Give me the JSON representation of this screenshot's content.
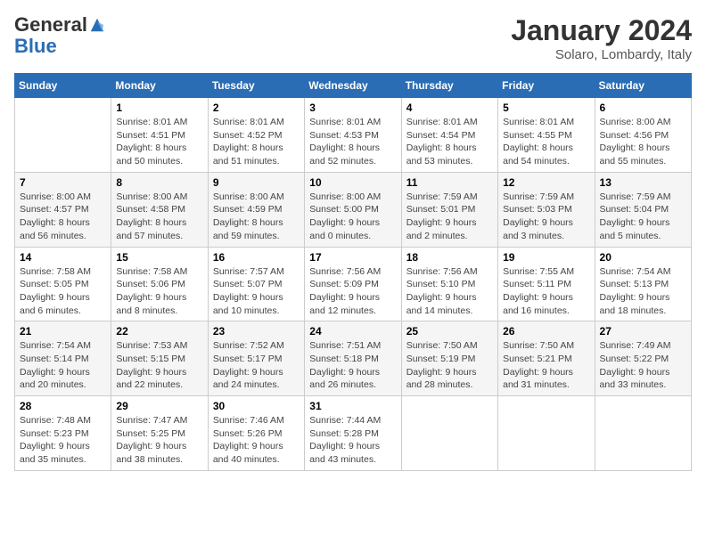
{
  "header": {
    "logo_general": "General",
    "logo_blue": "Blue",
    "month_title": "January 2024",
    "location": "Solaro, Lombardy, Italy"
  },
  "weekdays": [
    "Sunday",
    "Monday",
    "Tuesday",
    "Wednesday",
    "Thursday",
    "Friday",
    "Saturday"
  ],
  "weeks": [
    [
      {
        "day": "",
        "sunrise": "",
        "sunset": "",
        "daylight": ""
      },
      {
        "day": "1",
        "sunrise": "Sunrise: 8:01 AM",
        "sunset": "Sunset: 4:51 PM",
        "daylight": "Daylight: 8 hours and 50 minutes."
      },
      {
        "day": "2",
        "sunrise": "Sunrise: 8:01 AM",
        "sunset": "Sunset: 4:52 PM",
        "daylight": "Daylight: 8 hours and 51 minutes."
      },
      {
        "day": "3",
        "sunrise": "Sunrise: 8:01 AM",
        "sunset": "Sunset: 4:53 PM",
        "daylight": "Daylight: 8 hours and 52 minutes."
      },
      {
        "day": "4",
        "sunrise": "Sunrise: 8:01 AM",
        "sunset": "Sunset: 4:54 PM",
        "daylight": "Daylight: 8 hours and 53 minutes."
      },
      {
        "day": "5",
        "sunrise": "Sunrise: 8:01 AM",
        "sunset": "Sunset: 4:55 PM",
        "daylight": "Daylight: 8 hours and 54 minutes."
      },
      {
        "day": "6",
        "sunrise": "Sunrise: 8:00 AM",
        "sunset": "Sunset: 4:56 PM",
        "daylight": "Daylight: 8 hours and 55 minutes."
      }
    ],
    [
      {
        "day": "7",
        "sunrise": "Sunrise: 8:00 AM",
        "sunset": "Sunset: 4:57 PM",
        "daylight": "Daylight: 8 hours and 56 minutes."
      },
      {
        "day": "8",
        "sunrise": "Sunrise: 8:00 AM",
        "sunset": "Sunset: 4:58 PM",
        "daylight": "Daylight: 8 hours and 57 minutes."
      },
      {
        "day": "9",
        "sunrise": "Sunrise: 8:00 AM",
        "sunset": "Sunset: 4:59 PM",
        "daylight": "Daylight: 8 hours and 59 minutes."
      },
      {
        "day": "10",
        "sunrise": "Sunrise: 8:00 AM",
        "sunset": "Sunset: 5:00 PM",
        "daylight": "Daylight: 9 hours and 0 minutes."
      },
      {
        "day": "11",
        "sunrise": "Sunrise: 7:59 AM",
        "sunset": "Sunset: 5:01 PM",
        "daylight": "Daylight: 9 hours and 2 minutes."
      },
      {
        "day": "12",
        "sunrise": "Sunrise: 7:59 AM",
        "sunset": "Sunset: 5:03 PM",
        "daylight": "Daylight: 9 hours and 3 minutes."
      },
      {
        "day": "13",
        "sunrise": "Sunrise: 7:59 AM",
        "sunset": "Sunset: 5:04 PM",
        "daylight": "Daylight: 9 hours and 5 minutes."
      }
    ],
    [
      {
        "day": "14",
        "sunrise": "Sunrise: 7:58 AM",
        "sunset": "Sunset: 5:05 PM",
        "daylight": "Daylight: 9 hours and 6 minutes."
      },
      {
        "day": "15",
        "sunrise": "Sunrise: 7:58 AM",
        "sunset": "Sunset: 5:06 PM",
        "daylight": "Daylight: 9 hours and 8 minutes."
      },
      {
        "day": "16",
        "sunrise": "Sunrise: 7:57 AM",
        "sunset": "Sunset: 5:07 PM",
        "daylight": "Daylight: 9 hours and 10 minutes."
      },
      {
        "day": "17",
        "sunrise": "Sunrise: 7:56 AM",
        "sunset": "Sunset: 5:09 PM",
        "daylight": "Daylight: 9 hours and 12 minutes."
      },
      {
        "day": "18",
        "sunrise": "Sunrise: 7:56 AM",
        "sunset": "Sunset: 5:10 PM",
        "daylight": "Daylight: 9 hours and 14 minutes."
      },
      {
        "day": "19",
        "sunrise": "Sunrise: 7:55 AM",
        "sunset": "Sunset: 5:11 PM",
        "daylight": "Daylight: 9 hours and 16 minutes."
      },
      {
        "day": "20",
        "sunrise": "Sunrise: 7:54 AM",
        "sunset": "Sunset: 5:13 PM",
        "daylight": "Daylight: 9 hours and 18 minutes."
      }
    ],
    [
      {
        "day": "21",
        "sunrise": "Sunrise: 7:54 AM",
        "sunset": "Sunset: 5:14 PM",
        "daylight": "Daylight: 9 hours and 20 minutes."
      },
      {
        "day": "22",
        "sunrise": "Sunrise: 7:53 AM",
        "sunset": "Sunset: 5:15 PM",
        "daylight": "Daylight: 9 hours and 22 minutes."
      },
      {
        "day": "23",
        "sunrise": "Sunrise: 7:52 AM",
        "sunset": "Sunset: 5:17 PM",
        "daylight": "Daylight: 9 hours and 24 minutes."
      },
      {
        "day": "24",
        "sunrise": "Sunrise: 7:51 AM",
        "sunset": "Sunset: 5:18 PM",
        "daylight": "Daylight: 9 hours and 26 minutes."
      },
      {
        "day": "25",
        "sunrise": "Sunrise: 7:50 AM",
        "sunset": "Sunset: 5:19 PM",
        "daylight": "Daylight: 9 hours and 28 minutes."
      },
      {
        "day": "26",
        "sunrise": "Sunrise: 7:50 AM",
        "sunset": "Sunset: 5:21 PM",
        "daylight": "Daylight: 9 hours and 31 minutes."
      },
      {
        "day": "27",
        "sunrise": "Sunrise: 7:49 AM",
        "sunset": "Sunset: 5:22 PM",
        "daylight": "Daylight: 9 hours and 33 minutes."
      }
    ],
    [
      {
        "day": "28",
        "sunrise": "Sunrise: 7:48 AM",
        "sunset": "Sunset: 5:23 PM",
        "daylight": "Daylight: 9 hours and 35 minutes."
      },
      {
        "day": "29",
        "sunrise": "Sunrise: 7:47 AM",
        "sunset": "Sunset: 5:25 PM",
        "daylight": "Daylight: 9 hours and 38 minutes."
      },
      {
        "day": "30",
        "sunrise": "Sunrise: 7:46 AM",
        "sunset": "Sunset: 5:26 PM",
        "daylight": "Daylight: 9 hours and 40 minutes."
      },
      {
        "day": "31",
        "sunrise": "Sunrise: 7:44 AM",
        "sunset": "Sunset: 5:28 PM",
        "daylight": "Daylight: 9 hours and 43 minutes."
      },
      {
        "day": "",
        "sunrise": "",
        "sunset": "",
        "daylight": ""
      },
      {
        "day": "",
        "sunrise": "",
        "sunset": "",
        "daylight": ""
      },
      {
        "day": "",
        "sunrise": "",
        "sunset": "",
        "daylight": ""
      }
    ]
  ]
}
